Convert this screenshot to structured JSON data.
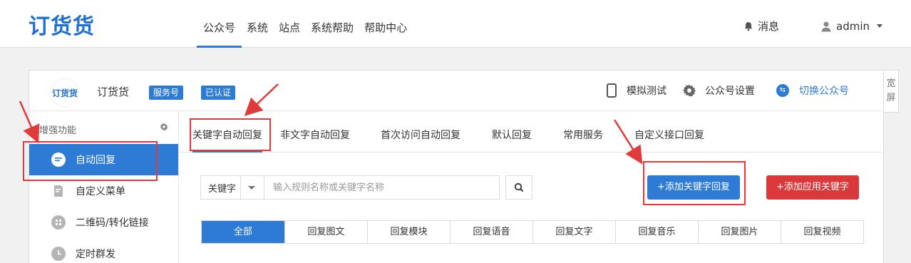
{
  "navbar": {
    "logo": "订货货",
    "links": [
      "公众号",
      "系统",
      "站点",
      "系统帮助",
      "帮助中心"
    ],
    "messages_label": "消息",
    "user_label": "admin"
  },
  "account": {
    "logo_text": "订货货",
    "name": "订货货",
    "tag_type": "服务号",
    "tag_verified": "已认证",
    "simulate_label": "模拟测试",
    "settings_label": "公众号设置",
    "switch_label": "切换公众号"
  },
  "wide_tab": "宽屏",
  "sidebar": {
    "header": "增强功能",
    "items": [
      {
        "label": "自动回复",
        "icon": "chat-icon"
      },
      {
        "label": "自定义菜单",
        "icon": "document-edit-icon"
      },
      {
        "label": "二维码/转化链接",
        "icon": "qrcode-icon"
      },
      {
        "label": "定时群发",
        "icon": "clock-icon"
      }
    ]
  },
  "tabs": [
    "关键字自动回复",
    "非文字自动回复",
    "首次访问自动回复",
    "默认回复",
    "常用服务",
    "自定义接口回复"
  ],
  "search": {
    "select_value": "关键字",
    "placeholder": "输入规则名称或关键字名称"
  },
  "buttons": {
    "add_keyword_reply": "+添加关键字回复",
    "add_app_keyword": "+添加应用关键字"
  },
  "filters": [
    "全部",
    "回复图文",
    "回复模块",
    "回复语音",
    "回复文字",
    "回复音乐",
    "回复图片",
    "回复视频"
  ],
  "colors": {
    "primary": "#2e7bd6",
    "danger": "#d9393a",
    "annotation": "#e03a3a"
  }
}
